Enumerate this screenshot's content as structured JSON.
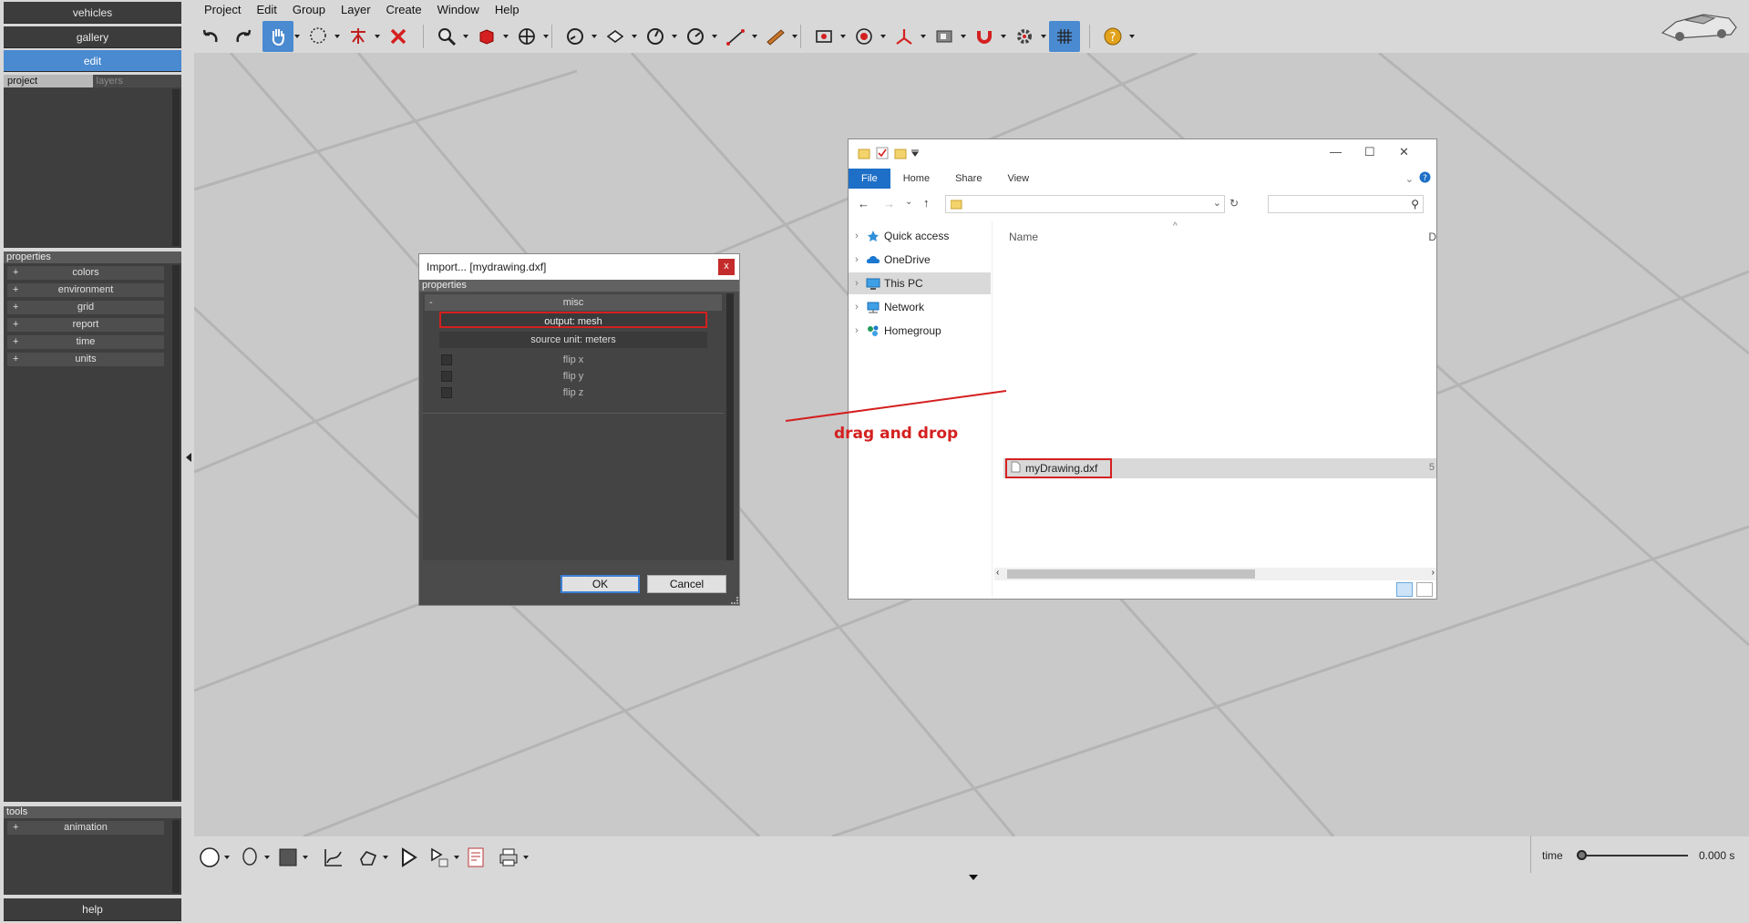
{
  "left_panel": {
    "nav": [
      "vehicles",
      "gallery",
      "edit"
    ],
    "tabs": [
      "project",
      "layers"
    ],
    "properties_header": "properties",
    "properties": [
      "colors",
      "environment",
      "grid",
      "report",
      "time",
      "units"
    ],
    "tools_header": "tools",
    "tools": [
      "animation"
    ],
    "help": "help",
    "expander": "+"
  },
  "menu": [
    "Project",
    "Edit",
    "Group",
    "Layer",
    "Create",
    "Window",
    "Help"
  ],
  "toolbar_icons": [
    "undo-icon",
    "redo-icon",
    "hand-pan-icon",
    "lasso-select-icon",
    "anchor-point-icon",
    "delete-x-icon",
    "zoom-icon",
    "red-box-icon",
    "move-icon",
    "dial-icon",
    "plane-icon",
    "dial-2-icon",
    "dial-3-icon",
    "measure-icon",
    "ruler-icon",
    "target-frame-icon",
    "record-icon",
    "axis-icon",
    "map-icon",
    "magnet-icon",
    "gear-icon",
    "grid-icon",
    "help-icon"
  ],
  "bottom": {
    "time_label": "time",
    "time_value": "0.000 s",
    "time_fraction": 0.0
  },
  "import_dialog": {
    "title": "Import... [mydrawing.dxf]",
    "close": "x",
    "properties_header": "properties",
    "misc": "misc",
    "collapse": "-",
    "output": "output: mesh",
    "source_unit": "source unit: meters",
    "flip_x": "flip x",
    "flip_y": "flip y",
    "flip_z": "flip z",
    "ok": "OK",
    "cancel": "Cancel"
  },
  "explorer": {
    "ribbon": [
      "File",
      "Home",
      "Share",
      "View"
    ],
    "nav": [
      "Quick access",
      "OneDrive",
      "This PC",
      "Network",
      "Homegroup"
    ],
    "column_name": "Name",
    "column_d": "D",
    "file_name": "myDrawing.dxf",
    "file_size_partial": "5"
  },
  "annotation": {
    "text": "drag and drop",
    "color": "#d42020"
  },
  "colors": {
    "accent": "#4a8ad0",
    "panel_dark": "#3e3e3e",
    "viewport": "#c9c9c9",
    "highlight_red": "#d42020"
  }
}
